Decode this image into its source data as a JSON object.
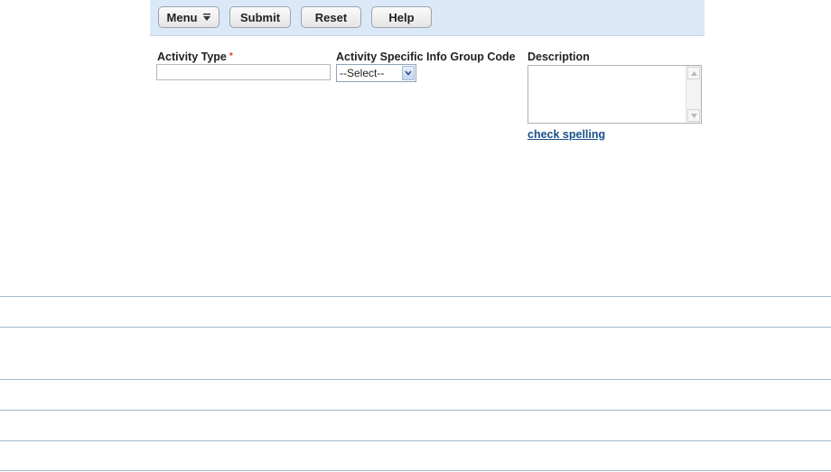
{
  "toolbar": {
    "menu_label": "Menu",
    "submit_label": "Submit",
    "reset_label": "Reset",
    "help_label": "Help"
  },
  "form": {
    "activity_type": {
      "label": "Activity Type",
      "required_marker": "*",
      "value": ""
    },
    "group_code": {
      "label": "Activity Specific Info Group Code",
      "selected": "--Select--"
    },
    "description": {
      "label": "Description",
      "value": ""
    },
    "check_spelling_label": "check spelling"
  },
  "colors": {
    "toolbar_bg": "#dbe8f7",
    "link": "#1a4f8a",
    "required": "#dd3333",
    "separator": "#9fbccf"
  },
  "icons": [
    "menu-arrow-icon",
    "select-dropdown-icon",
    "scroll-up-icon",
    "scroll-down-icon"
  ]
}
